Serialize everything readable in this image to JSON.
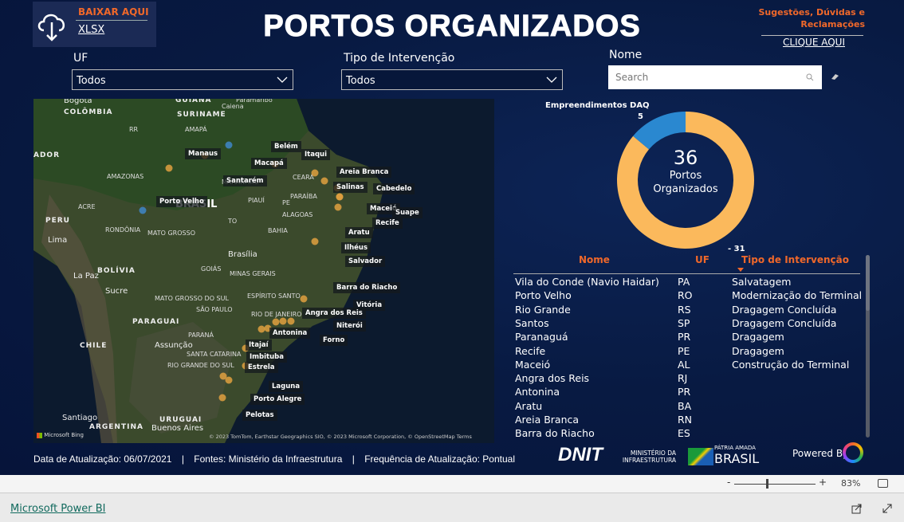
{
  "header": {
    "title": "PORTOS ORGANIZADOS",
    "download_label": "BAIXAR AQUI",
    "download_format": "XLSX",
    "feedback_label": "Sugestões, Dúvidas e Reclamações",
    "feedback_link": "CLIQUE AQUI"
  },
  "filters": {
    "uf_label": "UF",
    "uf_value": "Todos",
    "tipo_label": "Tipo de Intervenção",
    "tipo_value": "Todos",
    "nome_label": "Nome",
    "search_placeholder": "Search"
  },
  "map": {
    "ports": [
      "Manaus",
      "Belém",
      "Itaqui",
      "Macapá",
      "Santarém",
      "Areia Branca",
      "Salinas",
      "Cabedelo",
      "Porto Velho",
      "Maceió",
      "Suape",
      "Recife",
      "Aratu",
      "Ilhéus",
      "Salvador",
      "Barra do Riacho",
      "Vitória",
      "Angra dos Reis",
      "Niterói",
      "Antonina",
      "Forno",
      "Itajaí",
      "Imbituba",
      "Estrela",
      "Laguna",
      "Porto Alegre",
      "Pelotas"
    ],
    "places": [
      "Bogotá",
      "COLÔMBIA",
      "GUIANA",
      "Paramaribo",
      "SURINAME",
      "Caiena",
      "RR",
      "AMAPÁ",
      "ADOR",
      "AMAZONAS",
      "BRASIL",
      "ACRE",
      "PERU",
      "Lima",
      "RONDÔNIA",
      "MATO GROSSO",
      "MARANHÃO",
      "PIAUÍ",
      "TO",
      "BAHIA",
      "Brasília",
      "GOIÁS",
      "MINAS GERAIS",
      "BOLÍVIA",
      "La Paz",
      "Sucre",
      "MATO GROSSO DO SUL",
      "SÃO PAULO",
      "PARAGUAI",
      "Assunção",
      "CHILE",
      "PARANÁ",
      "SANTA CATARINA",
      "RIO GRANDE DO SUL",
      "Santiago",
      "URUGUAI",
      "ARGENTINA",
      "Buenos Aires",
      "PE",
      "ALAGOAS",
      "CEARÁ",
      "PARAÍBA",
      "ESPÍRITO SANTO",
      "RIO DE JANEIRO"
    ],
    "attribution": "© 2023 TomTom, Earthstar Geographics SIO, © 2023 Microsoft Corporation, © OpenStreetMap  Terms",
    "bing": "Microsoft Bing",
    "colors": {
      "port_dot": "#e0a040",
      "highlight_dot": "#3f86c8"
    }
  },
  "chart_data": {
    "type": "pie",
    "donut": true,
    "total": "36",
    "center_label": "Portos Organizados",
    "legend_title": "Empreendimentos DAQ",
    "slices": [
      {
        "value": 31,
        "label": "31",
        "color": "#fbb95c"
      },
      {
        "value": 5,
        "label": "5",
        "color": "#2a88d0"
      }
    ]
  },
  "table": {
    "columns": [
      "Nome",
      "UF",
      "Tipo de Intervenção"
    ],
    "sorted_column": "Tipo de Intervenção",
    "rows": [
      [
        "Vila do Conde (Navio Haidar)",
        "PA",
        "Salvatagem"
      ],
      [
        "Porto Velho",
        "RO",
        "Modernização do Terminal"
      ],
      [
        "Rio Grande",
        "RS",
        "Dragagem Concluída"
      ],
      [
        "Santos",
        "SP",
        "Dragagem Concluída"
      ],
      [
        "Paranaguá",
        "PR",
        "Dragagem"
      ],
      [
        "Recife",
        "PE",
        "Dragagem"
      ],
      [
        "Maceió",
        "AL",
        "Construção do Terminal"
      ],
      [
        "Angra dos Reis",
        "RJ",
        ""
      ],
      [
        "Antonina",
        "PR",
        ""
      ],
      [
        "Aratu",
        "BA",
        ""
      ],
      [
        "Areia Branca",
        "RN",
        ""
      ],
      [
        "Barra do Riacho",
        "ES",
        ""
      ]
    ]
  },
  "footer": {
    "date": "Data de Atualização: 06/07/2021",
    "sources": "Fontes: Ministério da Infraestrutura",
    "frequency": "Frequência de Atualização: Pontual",
    "sep": "|",
    "logos": {
      "dnit": "DNIT",
      "ministerio": "MINISTÉRIO DA INFRAESTRUTURA",
      "brasil_top": "PÁTRIA AMADA",
      "brasil": "BRASIL"
    },
    "powered": "Powered By"
  },
  "viewer": {
    "zoom_minus": "-",
    "zoom_plus": "+",
    "zoom_level": "83%",
    "zoom_fraction": 0.83,
    "brand_link": "Microsoft Power BI"
  }
}
